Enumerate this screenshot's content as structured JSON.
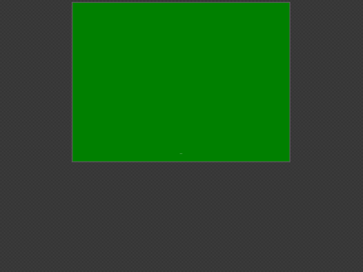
{
  "app": {
    "background_color": "#3a3a3a"
  },
  "stage": {
    "fill_color": "#008000",
    "caption": "—"
  }
}
